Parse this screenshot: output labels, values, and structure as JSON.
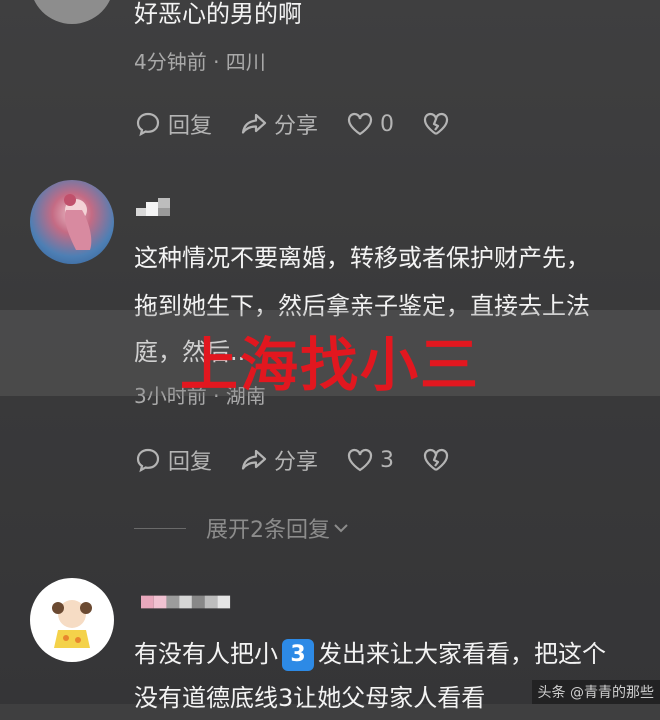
{
  "comments": [
    {
      "text_lines": [
        "好恶心的男的啊"
      ],
      "meta": "4分钟前 · 四川",
      "reply_label": "回复",
      "share_label": "分享",
      "likes": "0"
    },
    {
      "text_lines": [
        "这种情况不要离婚，转移或者保护财产先，",
        "拖到她生下，然后拿亲子鉴定，直接去上法",
        "庭，然后..."
      ],
      "meta": "3小时前 · 湖南",
      "reply_label": "回复",
      "share_label": "分享",
      "likes": "3",
      "expand_label": "展开2条回复"
    },
    {
      "text_before_badge": "有没有人把小",
      "badge": "3",
      "text_after_badge": "发出来让大家看看，把这个",
      "line2": "没有道德底线3让她父母家人看看"
    }
  ],
  "overlay_caption": "上海找小三",
  "watermark": "头条 @青青的那些"
}
